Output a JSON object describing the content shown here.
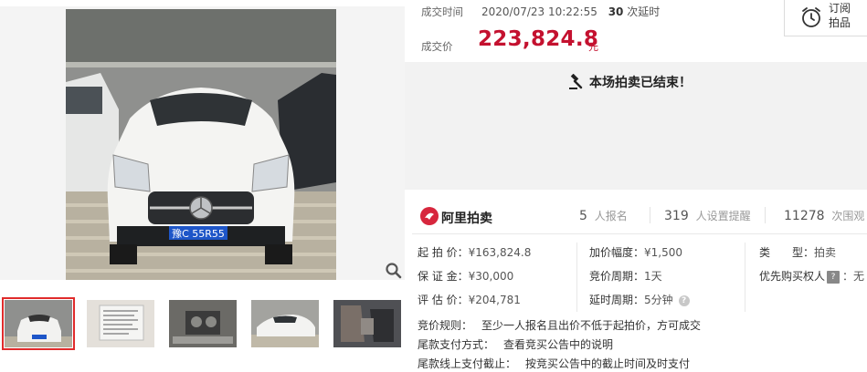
{
  "deal": {
    "time_label": "成交时间",
    "time_value": "2020/07/23 10:22:55",
    "delay_count": "30",
    "delay_suffix": "次延时",
    "price_label": "成交价",
    "price_value": "223,824.8",
    "price_unit": "元"
  },
  "subscribe": {
    "label": "订阅拍品",
    "icon": "alarm-clock-icon"
  },
  "status": {
    "message": "本场拍卖已结束！",
    "icon": "gavel-icon"
  },
  "platform": {
    "name": "阿里拍卖",
    "icon": "ali-auction-logo",
    "stats": [
      {
        "value": "5",
        "label": "人报名"
      },
      {
        "value": "319",
        "label": "人设置提醒"
      },
      {
        "value": "11278",
        "label": "次围观"
      }
    ]
  },
  "details": {
    "start_price_label": "起 拍 价：",
    "start_price_value": "¥163,824.8",
    "deposit_label": "保 证 金：",
    "deposit_value": "¥30,000",
    "appraisal_label": "评 估 价：",
    "appraisal_value": "¥204,781",
    "increment_label": "加价幅度：",
    "increment_value": "¥1,500",
    "period_label": "竞价周期：",
    "period_value": "1天",
    "delay_label": "延时周期：",
    "delay_value": "5分钟",
    "type_label": "类　　型：",
    "type_value": "拍卖",
    "priority_label": "优先购买权人",
    "priority_badge": "?",
    "priority_value": "：无"
  },
  "rules": [
    {
      "label": "竞价规则：",
      "value": "至少一人报名且出价不低于起拍价，方可成交"
    },
    {
      "label": "尾款支付方式：",
      "value": "查看竞买公告中的说明"
    },
    {
      "label": "尾款线上支付截止：",
      "value": "按竞买公告中的截止时间及时支付"
    }
  ],
  "photo": {
    "plate": "豫C 55R55"
  },
  "colors": {
    "price_red": "#c4112f",
    "selected_border": "#e02b2b",
    "ended_bg": "#f2f2f2"
  }
}
